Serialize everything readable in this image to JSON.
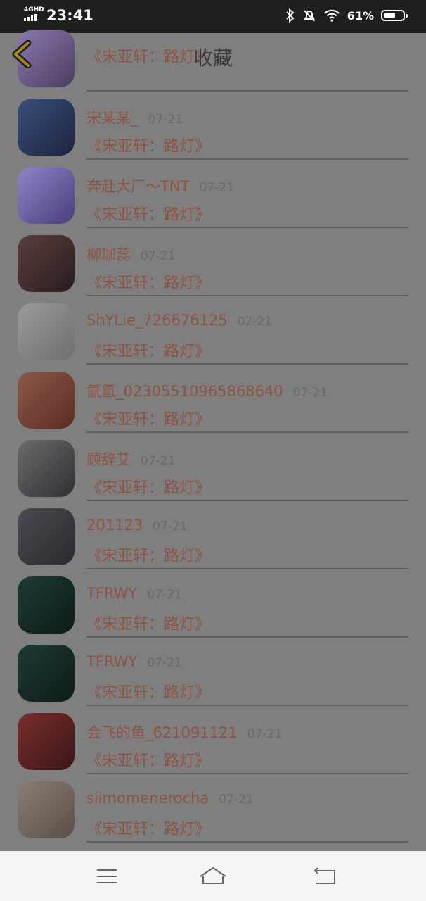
{
  "status_bar": {
    "network": "4GHD",
    "time": "23:41",
    "battery": "61%",
    "battery_level": 0.61
  },
  "header": {
    "title": "收藏"
  },
  "items": [
    {
      "name": "",
      "date": "",
      "song": "《宋亚轩：路灯》",
      "avatar_colors": [
        "#8a7ab0",
        "#4b3c5e"
      ]
    },
    {
      "name": "宋某某_",
      "date": "07-21",
      "song": "《宋亚轩：路灯》",
      "avatar_colors": [
        "#3a4f7a",
        "#1c2440"
      ]
    },
    {
      "name": "奔赴大厂～TNT",
      "date": "07-21",
      "song": "《宋亚轩：路灯》",
      "avatar_colors": [
        "#8e86c8",
        "#4c3d7a"
      ]
    },
    {
      "name": "柳珈蕊",
      "date": "07-21",
      "song": "《宋亚轩：路灯》",
      "avatar_colors": [
        "#5a3e3c",
        "#2a1d1e"
      ]
    },
    {
      "name": "ShYLie_726676125",
      "date": "07-21",
      "song": "《宋亚轩：路灯》",
      "avatar_colors": [
        "#9a9a9a",
        "#6f6f6f"
      ]
    },
    {
      "name": "氤氲_02305510965868640",
      "date": "07-21",
      "song": "《宋亚轩：路灯》",
      "avatar_colors": [
        "#8a5a48",
        "#5e2a22"
      ]
    },
    {
      "name": "顾辞艾",
      "date": "07-21",
      "song": "《宋亚轩：路灯》",
      "avatar_colors": [
        "#6c6a6a",
        "#2f3036"
      ]
    },
    {
      "name": "201123",
      "date": "07-21",
      "song": "《宋亚轩：路灯》",
      "avatar_colors": [
        "#4a4a52",
        "#2a2a30"
      ]
    },
    {
      "name": "TFRWY",
      "date": "07-21",
      "song": "《宋亚轩：路灯》",
      "avatar_colors": [
        "#1f3a35",
        "#0c1b19"
      ]
    },
    {
      "name": "TFRWY",
      "date": "07-21",
      "song": "《宋亚轩：路灯》",
      "avatar_colors": [
        "#1f3a35",
        "#0c1b19"
      ]
    },
    {
      "name": "会飞的鱼_621091121",
      "date": "07-21",
      "song": "《宋亚轩：路灯》",
      "avatar_colors": [
        "#7a2e2e",
        "#3a1616"
      ]
    },
    {
      "name": "siimomenerocha",
      "date": "07-21",
      "song": "《宋亚轩：路灯》",
      "avatar_colors": [
        "#8a7e72",
        "#5a4e48"
      ]
    }
  ],
  "icons": {
    "back": "chevron-left-icon",
    "menu": "menu-icon",
    "home": "home-icon",
    "return": "return-icon"
  },
  "colors": {
    "accent_text": "#8e5443",
    "back_chevron": "#a48a1e"
  }
}
